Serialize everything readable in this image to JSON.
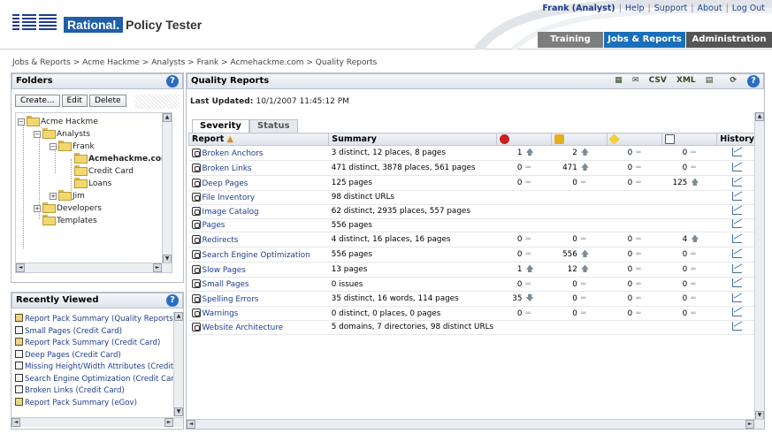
{
  "header": {
    "logo": "IBM",
    "brand_rational": "Rational.",
    "brand_product": "Policy Tester",
    "user": "Frank (Analyst)",
    "links": [
      "Help",
      "Support",
      "About",
      "Log Out"
    ],
    "tabs": [
      "Training",
      "Jobs & Reports",
      "Administration"
    ]
  },
  "breadcrumb": "Jobs & Reports > Acme Hackme > Analysts > Frank > Acmehackme.com > Quality Reports",
  "folders": {
    "title": "Folders",
    "buttons": [
      "Create...",
      "Edit",
      "Delete"
    ],
    "tree": [
      "Acme Hackme",
      "Analysts",
      "Frank",
      "Acmehackme.com",
      "Credit Card",
      "Loans",
      "Jim",
      "Developers",
      "Templates"
    ]
  },
  "recent": {
    "title": "Recently Viewed",
    "items": [
      "Report Pack Summary (Quality Reports)",
      "Small Pages (Credit Card)",
      "Report Pack Summary (Credit Card)",
      "Deep Pages (Credit Card)",
      "Missing Height/Width Attributes (Credit C",
      "Search Engine Optimization (Credit Card",
      "Broken Links (Credit Card)",
      "Report Pack Summary (eGov)"
    ]
  },
  "main": {
    "title": "Quality Reports",
    "toolbar": [
      "CSV",
      "XML"
    ],
    "updated_label": "Last Updated:",
    "updated_value": "10/1/2007 11:45:12 PM",
    "tabs": [
      "Severity",
      "Status"
    ],
    "columns": [
      "Report",
      "Summary",
      "History"
    ],
    "severity_colors": [
      "#cc1f1f",
      "#e0b020",
      "#f0d040",
      "#777777"
    ],
    "rows": [
      {
        "report": "Broken Anchors",
        "summary": "3 distinct, 12 places, 8 pages",
        "c": [
          "1",
          "2",
          "0",
          "0"
        ],
        "t": [
          "up",
          "up",
          "eq",
          "eq"
        ]
      },
      {
        "report": "Broken Links",
        "summary": "471 distinct, 3878 places, 561 pages",
        "c": [
          "0",
          "471",
          "0",
          "0"
        ],
        "t": [
          "eq",
          "up",
          "eq",
          "eq"
        ]
      },
      {
        "report": "Deep Pages",
        "summary": "125 pages",
        "c": [
          "0",
          "0",
          "0",
          "125"
        ],
        "t": [
          "eq",
          "eq",
          "eq",
          "up"
        ]
      },
      {
        "report": "File Inventory",
        "summary": "98 distinct URLs",
        "c": [
          "",
          "",
          "",
          ""
        ],
        "t": [
          "",
          "",
          "",
          ""
        ]
      },
      {
        "report": "Image Catalog",
        "summary": "62 distinct, 2935 places, 557 pages",
        "c": [
          "",
          "",
          "",
          ""
        ],
        "t": [
          "",
          "",
          "",
          ""
        ]
      },
      {
        "report": "Pages",
        "summary": "556 pages",
        "c": [
          "",
          "",
          "",
          ""
        ],
        "t": [
          "",
          "",
          "",
          ""
        ]
      },
      {
        "report": "Redirects",
        "summary": "4 distinct, 16 places, 16 pages",
        "c": [
          "0",
          "0",
          "0",
          "4"
        ],
        "t": [
          "eq",
          "eq",
          "eq",
          "up"
        ]
      },
      {
        "report": "Search Engine Optimization",
        "summary": "556 pages",
        "c": [
          "0",
          "556",
          "0",
          "0"
        ],
        "t": [
          "eq",
          "up",
          "eq",
          "eq"
        ]
      },
      {
        "report": "Slow Pages",
        "summary": "13 pages",
        "c": [
          "1",
          "12",
          "0",
          "0"
        ],
        "t": [
          "up",
          "up",
          "eq",
          "eq"
        ]
      },
      {
        "report": "Small Pages",
        "summary": "0 issues",
        "c": [
          "0",
          "0",
          "0",
          "0"
        ],
        "t": [
          "eq",
          "eq",
          "eq",
          "eq"
        ]
      },
      {
        "report": "Spelling Errors",
        "summary": "35 distinct, 16 words, 114 pages",
        "c": [
          "35",
          "0",
          "0",
          "0"
        ],
        "t": [
          "down",
          "eq",
          "eq",
          "eq"
        ]
      },
      {
        "report": "Warnings",
        "summary": "0 distinct, 0 places, 0 pages",
        "c": [
          "0",
          "0",
          "0",
          "0"
        ],
        "t": [
          "eq",
          "eq",
          "eq",
          "eq"
        ]
      },
      {
        "report": "Website Architecture",
        "summary": "5 domains, 7 directories, 98 distinct URLs",
        "c": [
          "",
          "",
          "",
          ""
        ],
        "t": [
          "",
          "",
          "",
          ""
        ]
      }
    ]
  }
}
